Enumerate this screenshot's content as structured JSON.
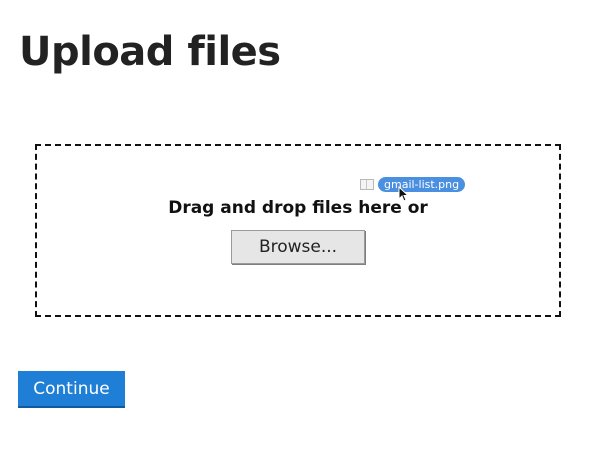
{
  "page": {
    "title": "Upload files"
  },
  "drop_zone": {
    "instruction": "Drag and drop files here or",
    "browse_label": "Browse..."
  },
  "drag_ghost": {
    "file_name": "gmail-list.png",
    "file_icon": "document-icon",
    "cursor_icon": "arrow-cursor-icon"
  },
  "actions": {
    "continue_label": "Continue"
  },
  "colors": {
    "primary_button": "#1f7fd6",
    "drag_pill": "#4a8fe0",
    "secondary_button": "#e6e6e6"
  }
}
